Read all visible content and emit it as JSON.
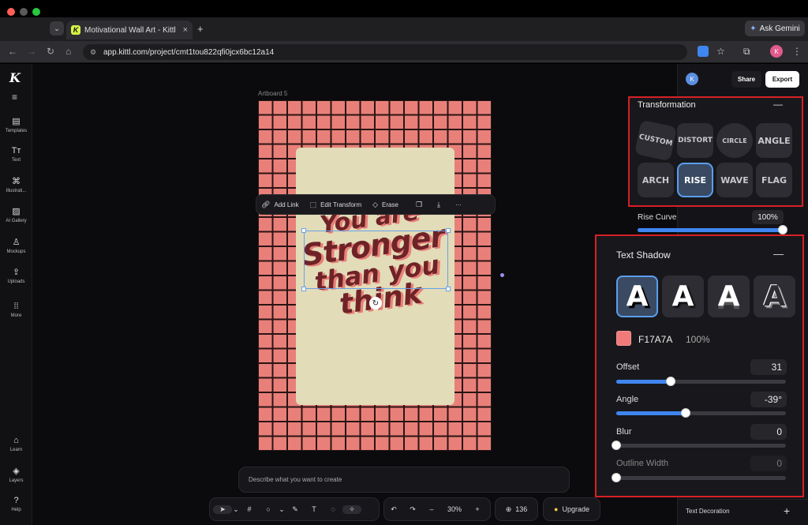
{
  "browser": {
    "tab_title": "Motivational Wall Art - Kittl",
    "tab_close": "×",
    "new_tab": "+",
    "url": "app.kittl.com/project/cmt1tou822qfi0jcx6bc12a14",
    "ask_gemini": "Ask Gemini",
    "profile_initial": "K"
  },
  "sidebar": {
    "logo": "K",
    "items": [
      {
        "label": "Templates"
      },
      {
        "label": "Text"
      },
      {
        "label": "Illustrati..."
      },
      {
        "label": "AI Gallery"
      },
      {
        "label": "Mockups"
      },
      {
        "label": "Uploads"
      },
      {
        "label": "More"
      }
    ],
    "bottom": [
      {
        "label": "Learn"
      },
      {
        "label": "Layers"
      },
      {
        "label": "Help"
      }
    ]
  },
  "canvas": {
    "artboard_label": "Artboard 5",
    "quote": [
      "You are",
      "Stronger",
      "than you",
      "think"
    ]
  },
  "context_toolbar": {
    "add_link": "Add Link",
    "edit_transform": "Edit Transform",
    "erase": "Erase",
    "more": "···"
  },
  "prompt": {
    "placeholder": "Describe what you want to create"
  },
  "bottom_toolbar": {
    "zoom": "30%",
    "zoom_minus": "–",
    "zoom_plus": "+",
    "credits": "136",
    "upgrade": "Upgrade"
  },
  "header": {
    "avatar": "K",
    "share": "Share",
    "export": "Export"
  },
  "transformation": {
    "title": "Transformation",
    "collapse": "—",
    "options": [
      "CUSTOM",
      "DISTORT",
      "CIRCLE",
      "ANGLE",
      "ARCH",
      "RISE",
      "WAVE",
      "FLAG"
    ],
    "selected": "RISE",
    "rise_curve_label": "Rise Curve",
    "rise_curve_value": "100%",
    "rise_curve_fraction": 1.0
  },
  "text_shadow": {
    "title": "Text Shadow",
    "collapse": "—",
    "styles": [
      "A",
      "A",
      "A",
      "A"
    ],
    "selected_index": 0,
    "color_hex": "F17A7A",
    "color": "#F17A7A",
    "opacity": "100%",
    "offset_label": "Offset",
    "offset_value": "31",
    "offset_fraction": 0.32,
    "angle_label": "Angle",
    "angle_value": "-39°",
    "angle_fraction": 0.41,
    "blur_label": "Blur",
    "blur_value": "0",
    "blur_fraction": 0,
    "outline_label": "Outline Width",
    "outline_value": "0",
    "outline_fraction": 0
  },
  "text_decoration": {
    "label": "Text Decoration",
    "add": "+"
  },
  "colors": {
    "accent": "#3f86f0",
    "highlight_border": "#d81f26",
    "artboard_bg": "#e88079",
    "card_bg": "#e2dcb8",
    "text_color": "#6e2327"
  }
}
